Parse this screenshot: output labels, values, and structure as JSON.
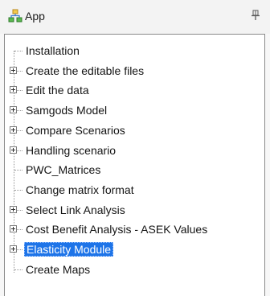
{
  "panel": {
    "title": "App",
    "icon": "app-hierarchy-icon",
    "pin_icon": "pin-icon"
  },
  "colors": {
    "selection": "#1e74e8",
    "border": "#8a8a8a"
  },
  "tree": {
    "items": [
      {
        "label": "Installation",
        "expandable": false,
        "selected": false
      },
      {
        "label": "Create the editable files",
        "expandable": true,
        "selected": false
      },
      {
        "label": "Edit the data",
        "expandable": true,
        "selected": false
      },
      {
        "label": "Samgods Model",
        "expandable": true,
        "selected": false
      },
      {
        "label": "Compare Scenarios",
        "expandable": true,
        "selected": false
      },
      {
        "label": "Handling scenario",
        "expandable": true,
        "selected": false
      },
      {
        "label": "PWC_Matrices",
        "expandable": false,
        "selected": false
      },
      {
        "label": "Change matrix format",
        "expandable": false,
        "selected": false
      },
      {
        "label": "Select Link Analysis",
        "expandable": true,
        "selected": false
      },
      {
        "label": "Cost Benefit Analysis - ASEK Values",
        "expandable": true,
        "selected": false
      },
      {
        "label": "Elasticity Module",
        "expandable": true,
        "selected": true
      },
      {
        "label": "Create Maps",
        "expandable": false,
        "selected": false
      }
    ]
  }
}
